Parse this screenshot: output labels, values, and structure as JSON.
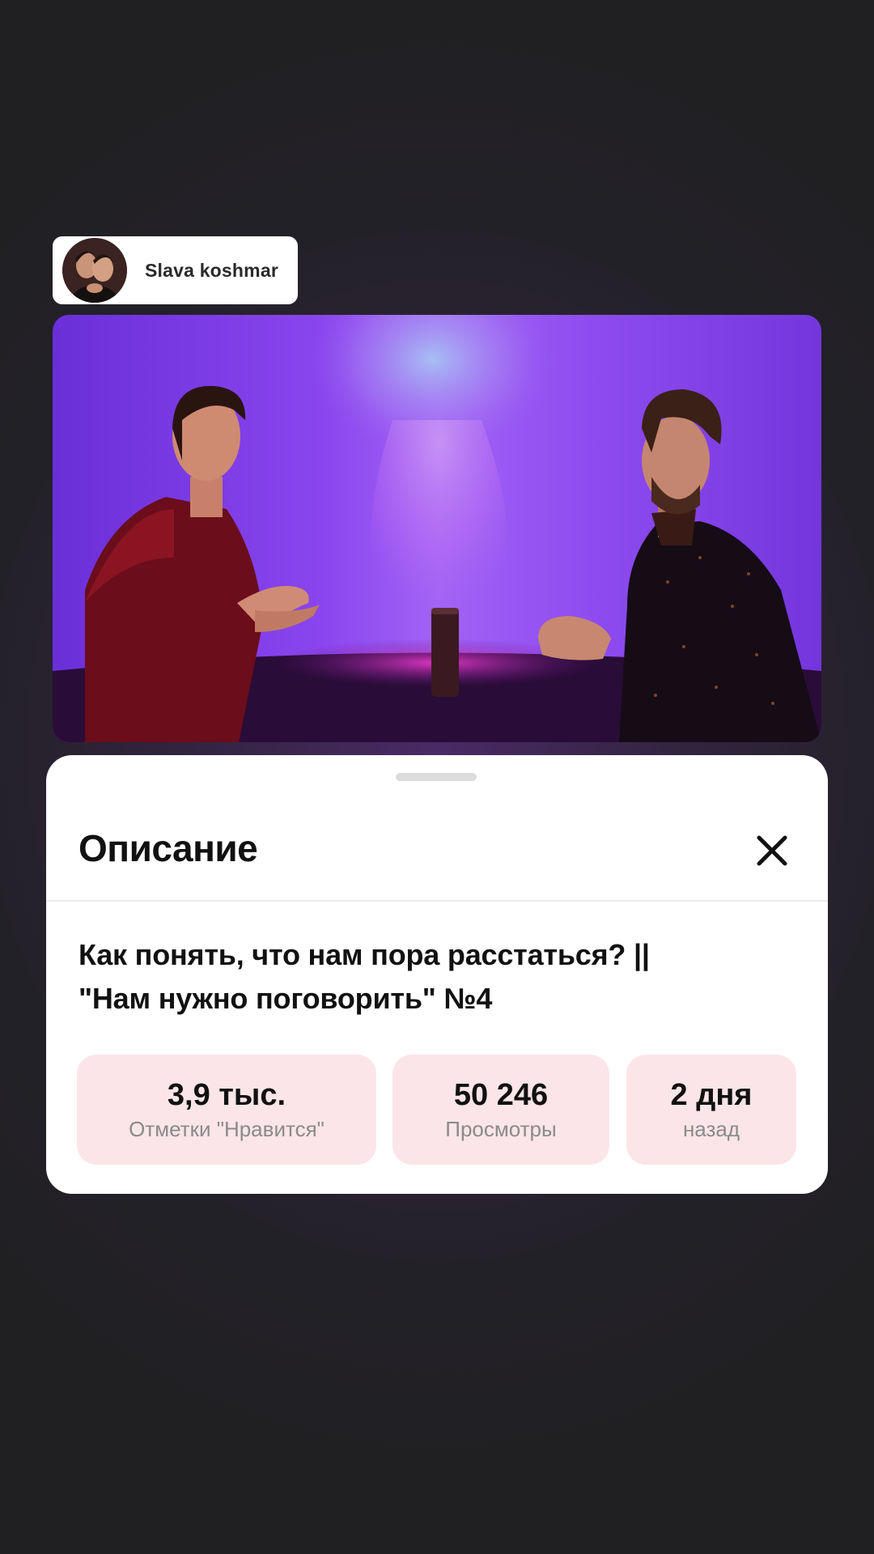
{
  "author": {
    "name": "Slava koshmar"
  },
  "sheet": {
    "title": "Описание",
    "video_title_line1": "Как понять, что нам пора расстаться? ||",
    "video_title_line2": "\"Нам нужно поговорить\" №4",
    "stats": [
      {
        "value": "3,9 тыс.",
        "label": "Отметки \"Нравится\""
      },
      {
        "value": "50 246",
        "label": "Просмотры"
      },
      {
        "value": "2 дня",
        "label": "назад"
      }
    ]
  },
  "icons": {
    "close": "close-icon",
    "avatar": "avatar"
  },
  "colors": {
    "stat_background": "#fbe5e8",
    "video_light": "#9b4ff0",
    "page_background": "#222124"
  }
}
